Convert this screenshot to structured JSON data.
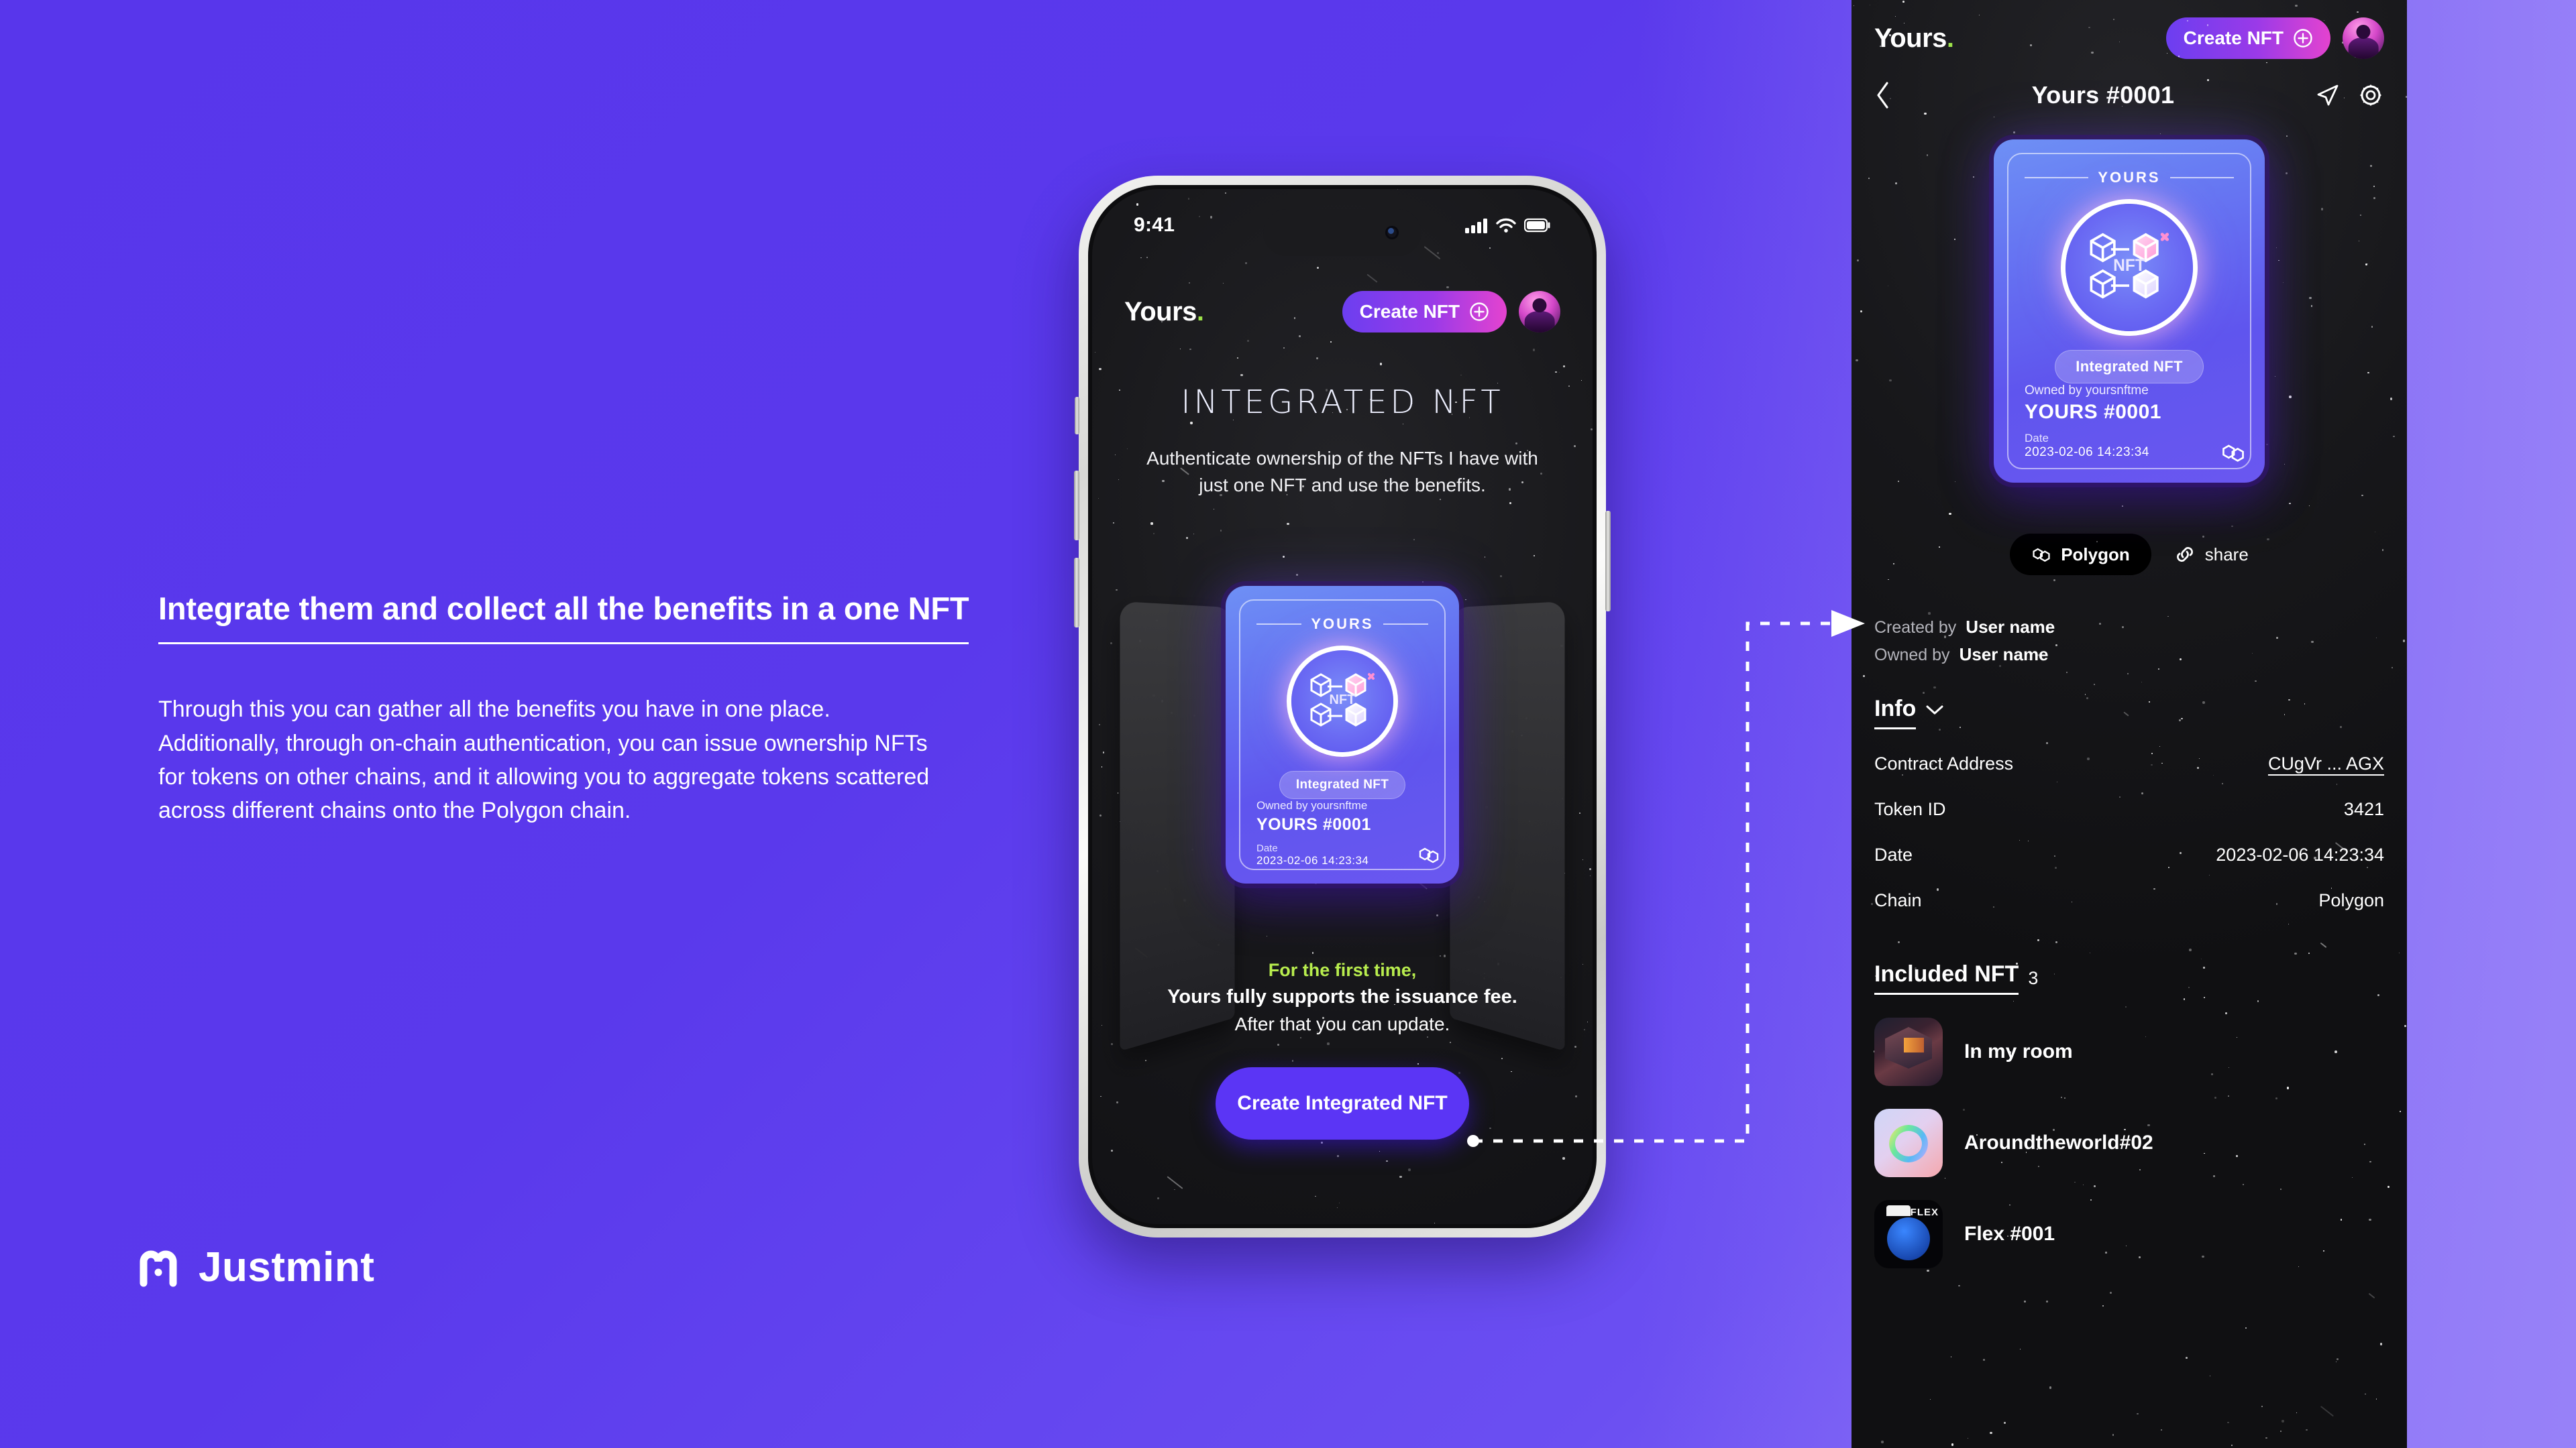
{
  "left": {
    "headline": "Integrate them and collect all the benefits in a one NFT",
    "body": "Through this you can gather all the benefits you have in one place. Additionally, through on-chain authentication, you can issue ownership NFTs for tokens on other chains, and it allowing you to aggregate tokens scattered across different chains onto the Polygon chain.",
    "logo_word": "Justmint"
  },
  "phone": {
    "status": {
      "time": "9:41"
    },
    "brand": {
      "name": "Yours",
      "dot": "."
    },
    "create_button": "Create NFT",
    "hero": {
      "title": "INTEGRATED NFT",
      "subtitle": "Authenticate ownership of the NFTs I have with just one NFT and use the benefits."
    },
    "card": {
      "top_label": "YOURS",
      "orb_word": "NFT",
      "badge": "Integrated NFT",
      "owner": "Owned by yoursnftme",
      "name": "YOURS #0001",
      "date_label": "Date",
      "date": "2023-02-06 14:23:34"
    },
    "bottom": {
      "line1": "For the first time,",
      "line2": "Yours fully supports the issuance fee.",
      "line3": "After that you can update.",
      "cta": "Create Integrated NFT"
    }
  },
  "panel": {
    "brand": {
      "name": "Yours",
      "dot": "."
    },
    "create_button": "Create NFT",
    "nav_title": "Yours #0001",
    "card": {
      "top_label": "YOURS",
      "orb_word": "NFT",
      "badge": "Integrated NFT",
      "owner": "Owned by yoursnftme",
      "name": "YOURS #0001",
      "date_label": "Date",
      "date": "2023-02-06 14:23:34"
    },
    "chain_chip": "Polygon",
    "share_chip": "share",
    "credits": [
      {
        "key": "Created by",
        "value": "User name"
      },
      {
        "key": "Owned by",
        "value": "User name"
      }
    ],
    "info": {
      "title": "Info",
      "rows": [
        {
          "key": "Contract Address",
          "value": "CUgVr ... AGX",
          "link": true
        },
        {
          "key": "Token ID",
          "value": "3421",
          "link": false
        },
        {
          "key": "Date",
          "value": "2023-02-06 14:23:34",
          "link": false
        },
        {
          "key": "Chain",
          "value": "Polygon",
          "link": false
        }
      ]
    },
    "included": {
      "title": "Included NFT",
      "count": "3",
      "items": [
        {
          "name": "In my room"
        },
        {
          "name": "Aroundtheworld#02"
        },
        {
          "name": "Flex #001"
        }
      ]
    }
  },
  "colors": {
    "background": "#5836eb",
    "accent_green": "#9ee34a",
    "cta_purple": "#5b35f5",
    "panel_bg": "#17171a",
    "card_blue": "#6675f2"
  }
}
